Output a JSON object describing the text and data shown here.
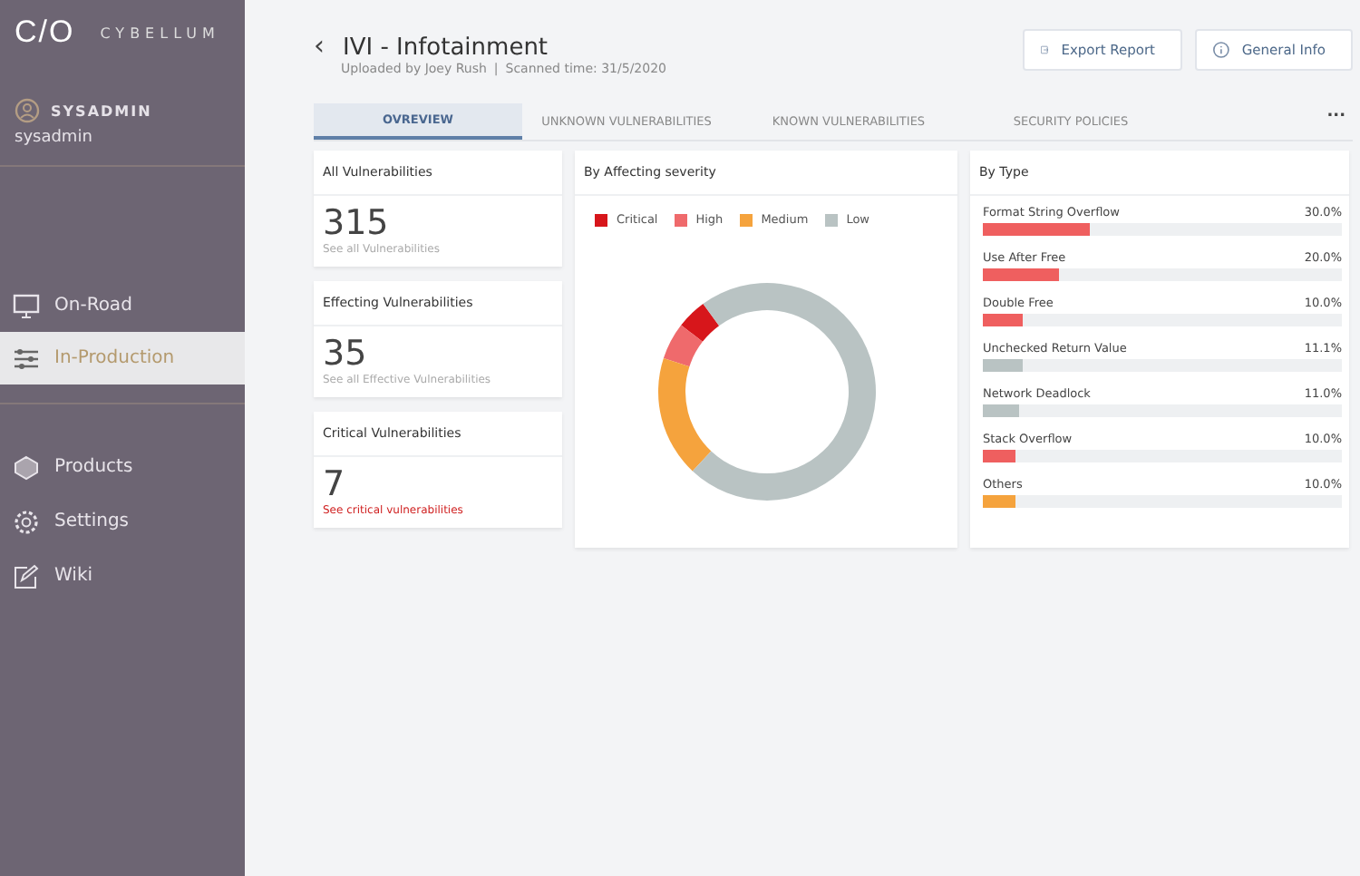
{
  "sidebar": {
    "logo": "C/O",
    "brand": "CYBELLUM",
    "user": {
      "name": "SYSADMIN",
      "login": "sysadmin"
    },
    "items": [
      {
        "label": "On-Road",
        "kind": "monitor",
        "selected": false
      },
      {
        "label": "In-Production",
        "kind": "sliders",
        "selected": true
      }
    ],
    "more_items": [
      {
        "label": "Products",
        "kind": "box",
        "selected": false
      },
      {
        "label": "Settings",
        "kind": "gear",
        "selected": false
      },
      {
        "label": "Wiki",
        "kind": "edit",
        "selected": false
      }
    ]
  },
  "header": {
    "back": "‹",
    "title": "IVI - Infotainment",
    "uploaded": "Uploaded by Joey Rush",
    "separator": "|",
    "scanned": "Scanned time: 31/5/2020",
    "buttons": [
      {
        "label": "Export Report",
        "kind": "export"
      },
      {
        "label": "General Info",
        "kind": "info"
      }
    ]
  },
  "tabs": [
    {
      "label": "OVREVIEW",
      "selected": true
    },
    {
      "label": "UNKNOWN VULNERABILITIES",
      "selected": false
    },
    {
      "label": "KNOWN VULNERABILITIES",
      "selected": false
    },
    {
      "label": "SECURITY POLICIES",
      "selected": false
    }
  ],
  "more": "...",
  "stats": [
    {
      "title": "All Vulnerabilities",
      "value": "315",
      "link": "See all Vulnerabilities",
      "alert": false
    },
    {
      "title": "Effecting Vulnerabilities",
      "value": "35",
      "link": "See all Effective Vulnerabilities",
      "alert": false
    },
    {
      "title": "Critical Vulnerabilities",
      "value": "7",
      "link": "See critical vulnerabilities",
      "alert": true
    }
  ],
  "severity": {
    "title": "By Affecting severity",
    "legend": [
      {
        "label": "Critical",
        "color": "#d7161b"
      },
      {
        "label": "High",
        "color": "#ef6a6c"
      },
      {
        "label": "Medium",
        "color": "#f5a33d"
      },
      {
        "label": "Low",
        "color": "#b9c3c3"
      }
    ]
  },
  "by_type": {
    "title": "By Type",
    "items": [
      {
        "label": "Format String Overflow",
        "value": "30.0%",
        "level": 0.3,
        "color": "#ef5f5f"
      },
      {
        "label": "Use After Free",
        "value": "20.0%",
        "level": 0.21,
        "color": "#ef5f5f"
      },
      {
        "label": "Double Free",
        "value": "10.0%",
        "level": 0.11,
        "color": "#ef5f5f"
      },
      {
        "label": "Unchecked Return Value",
        "value": "11.1%",
        "level": 0.11,
        "color": "#b9c3c3"
      },
      {
        "label": "Network Deadlock",
        "value": "11.0%",
        "level": 0.1,
        "color": "#b9c3c3"
      },
      {
        "label": "Stack Overflow",
        "value": "10.0%",
        "level": 0.09,
        "color": "#ef5f5f"
      },
      {
        "label": "Others",
        "value": "10.0%",
        "level": 0.09,
        "color": "#f5a33d"
      }
    ]
  }
}
